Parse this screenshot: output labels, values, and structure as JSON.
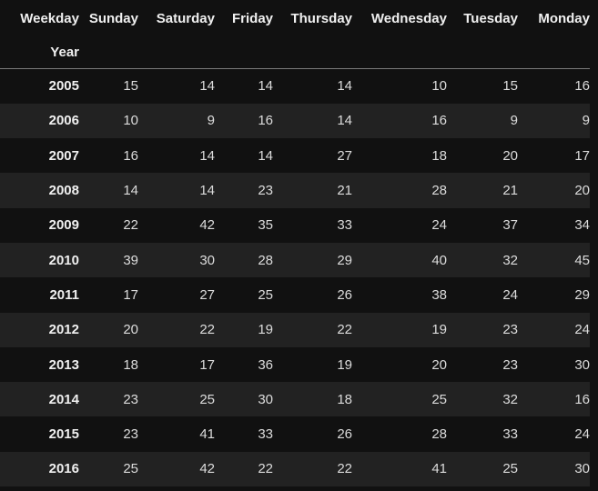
{
  "table": {
    "columns_name": "Weekday",
    "index_name": "Year",
    "columns": [
      "Sunday",
      "Saturday",
      "Friday",
      "Thursday",
      "Wednesday",
      "Tuesday",
      "Monday"
    ],
    "rows": [
      {
        "year": "2005",
        "values": [
          "15",
          "14",
          "14",
          "14",
          "10",
          "15",
          "16"
        ]
      },
      {
        "year": "2006",
        "values": [
          "10",
          "9",
          "16",
          "14",
          "16",
          "9",
          "9"
        ]
      },
      {
        "year": "2007",
        "values": [
          "16",
          "14",
          "14",
          "27",
          "18",
          "20",
          "17"
        ]
      },
      {
        "year": "2008",
        "values": [
          "14",
          "14",
          "23",
          "21",
          "28",
          "21",
          "20"
        ]
      },
      {
        "year": "2009",
        "values": [
          "22",
          "42",
          "35",
          "33",
          "24",
          "37",
          "34"
        ]
      },
      {
        "year": "2010",
        "values": [
          "39",
          "30",
          "28",
          "29",
          "40",
          "32",
          "45"
        ]
      },
      {
        "year": "2011",
        "values": [
          "17",
          "27",
          "25",
          "26",
          "38",
          "24",
          "29"
        ]
      },
      {
        "year": "2012",
        "values": [
          "20",
          "22",
          "19",
          "22",
          "19",
          "23",
          "24"
        ]
      },
      {
        "year": "2013",
        "values": [
          "18",
          "17",
          "36",
          "19",
          "20",
          "23",
          "30"
        ]
      },
      {
        "year": "2014",
        "values": [
          "23",
          "25",
          "30",
          "18",
          "25",
          "32",
          "16"
        ]
      },
      {
        "year": "2015",
        "values": [
          "23",
          "41",
          "33",
          "26",
          "28",
          "33",
          "24"
        ]
      },
      {
        "year": "2016",
        "values": [
          "25",
          "42",
          "22",
          "22",
          "41",
          "25",
          "30"
        ]
      }
    ]
  },
  "colors": {
    "background": "#111111",
    "row_stripe": "#222222",
    "header_rule": "#7a7a7a",
    "text": "#e6e6e6"
  }
}
